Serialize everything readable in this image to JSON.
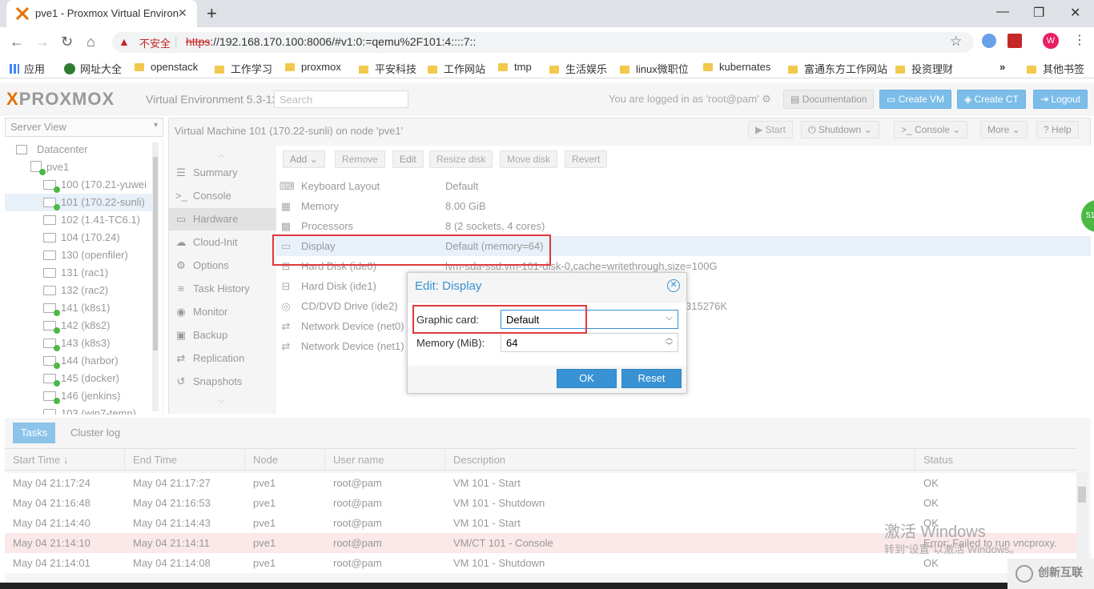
{
  "browser": {
    "tab_title": "pve1 - Proxmox Virtual Environment",
    "tab_close": "✕",
    "new_tab": "+",
    "win_min": "—",
    "win_max": "❐",
    "win_close": "✕",
    "nav_back": "←",
    "nav_forward": "→",
    "nav_reload": "↻",
    "nav_home": "⌂",
    "insecure_label": "不安全",
    "url_scheme": "https",
    "url_rest": "://192.168.170.100:8006/#v1:0:=qemu%2F101:4::::7::",
    "profile_initial": "W",
    "bookmarks": [
      "应用",
      "网址大全",
      "openstack",
      "工作学习",
      "proxmox",
      "平安科技",
      "工作网站",
      "tmp",
      "生活娱乐",
      "linux微职位",
      "kubernates",
      "富通东方工作网站",
      "投资理财",
      "»",
      "其他书签"
    ]
  },
  "pve": {
    "logo_x": "X",
    "logo_text": "PROXMOX",
    "version": "Virtual Environment 5.3-12",
    "search_placeholder": "Search",
    "logged_in": "You are logged in as 'root@pam'",
    "documentation": "Documentation",
    "create_vm": "Create VM",
    "create_ct": "Create CT",
    "logout": "Logout"
  },
  "server_view": {
    "label": "Server View",
    "datacenter": "Datacenter",
    "node": "pve1",
    "vms": [
      {
        "label": "100 (170.21-yuwei",
        "running": true
      },
      {
        "label": "101 (170.22-sunli)",
        "running": true
      },
      {
        "label": "102 (1.41-TC6.1)",
        "running": false
      },
      {
        "label": "104 (170.24)",
        "running": false
      },
      {
        "label": "130 (openfiler)",
        "running": false
      },
      {
        "label": "131 (rac1)",
        "running": false
      },
      {
        "label": "132 (rac2)",
        "running": false
      },
      {
        "label": "141 (k8s1)",
        "running": true
      },
      {
        "label": "142 (k8s2)",
        "running": true
      },
      {
        "label": "143 (k8s3)",
        "running": true
      },
      {
        "label": "144 (harbor)",
        "running": true
      },
      {
        "label": "145 (docker)",
        "running": true
      },
      {
        "label": "146 (jenkins)",
        "running": true
      },
      {
        "label": "103 (win7-temp)",
        "running": false
      }
    ]
  },
  "vm": {
    "title": "Virtual Machine 101 (170.22-sunli) on node 'pve1'",
    "start": "Start",
    "shutdown": "Shutdown",
    "console": "Console",
    "more": "More",
    "help": "Help"
  },
  "nav": [
    "Summary",
    "Console",
    "Hardware",
    "Cloud-Init",
    "Options",
    "Task History",
    "Monitor",
    "Backup",
    "Replication",
    "Snapshots"
  ],
  "hw_toolbar": [
    "Add",
    "Remove",
    "Edit",
    "Resize disk",
    "Move disk",
    "Revert"
  ],
  "hardware": [
    {
      "key": "Keyboard Layout",
      "value": "Default"
    },
    {
      "key": "Memory",
      "value": "8.00 GiB"
    },
    {
      "key": "Processors",
      "value": "8 (2 sockets, 4 cores)"
    },
    {
      "key": "Display",
      "value": "Default (memory=64)"
    },
    {
      "key": "Hard Disk (ide0)",
      "value": "lvm-sda-ssd:vm-101-disk-0,cache=writethrough,size=100G"
    },
    {
      "key": "Hard Disk (ide1)",
      "value": ""
    },
    {
      "key": "CD/DVD Drive (ide2)",
      "value": "315276K"
    },
    {
      "key": "Network Device (net0)",
      "value": ""
    },
    {
      "key": "Network Device (net1)",
      "value": ""
    }
  ],
  "dialog": {
    "title": "Edit: Display",
    "graphic_label": "Graphic card:",
    "graphic_value": "Default",
    "memory_label": "Memory (MiB):",
    "memory_value": "64",
    "ok": "OK",
    "reset": "Reset"
  },
  "tasks": {
    "tabs": [
      "Tasks",
      "Cluster log"
    ],
    "columns": [
      "Start Time ↓",
      "End Time",
      "Node",
      "User name",
      "Description",
      "Status"
    ],
    "rows": [
      {
        "start": "May 04 21:17:24",
        "end": "May 04 21:17:27",
        "node": "pve1",
        "user": "root@pam",
        "desc": "VM 101 - Start",
        "status": "OK",
        "error": false
      },
      {
        "start": "May 04 21:16:48",
        "end": "May 04 21:16:53",
        "node": "pve1",
        "user": "root@pam",
        "desc": "VM 101 - Shutdown",
        "status": "OK",
        "error": false
      },
      {
        "start": "May 04 21:14:40",
        "end": "May 04 21:14:43",
        "node": "pve1",
        "user": "root@pam",
        "desc": "VM 101 - Start",
        "status": "OK",
        "error": false
      },
      {
        "start": "May 04 21:14:10",
        "end": "May 04 21:14:11",
        "node": "pve1",
        "user": "root@pam",
        "desc": "VM/CT 101 - Console",
        "status": "Error: Failed to run vncproxy.",
        "error": true
      },
      {
        "start": "May 04 21:14:01",
        "end": "May 04 21:14:08",
        "node": "pve1",
        "user": "root@pam",
        "desc": "VM 101 - Shutdown",
        "status": "OK",
        "error": false
      }
    ]
  },
  "overlay": {
    "watermark_title": "激活 Windows",
    "watermark_sub": "转到\"设置\"以激活 Windows。",
    "brand": "创新互联",
    "bubble": "51"
  },
  "colors": {
    "accent": "#3892d4",
    "brand_orange": "#e57000",
    "highlight_red": "#e0393e"
  }
}
